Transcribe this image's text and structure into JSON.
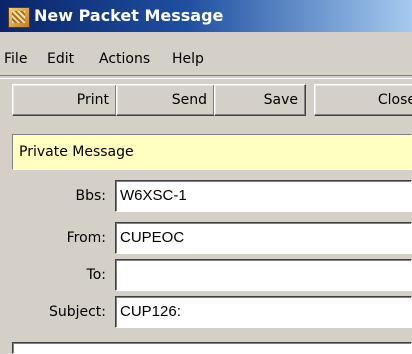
{
  "window": {
    "title": "New Packet Message",
    "icon": "packet-app-icon"
  },
  "menu": {
    "items": [
      "File",
      "Edit",
      "Actions",
      "Help"
    ]
  },
  "toolbar": {
    "buttons": [
      "Print",
      "Send",
      "Save",
      "Close"
    ]
  },
  "banner": {
    "text": "Private Message",
    "color": "#ffffc0"
  },
  "form": {
    "bbs": {
      "label": "Bbs:",
      "value": "W6XSC-1"
    },
    "from": {
      "label": "From:",
      "value": "CUPEOC"
    },
    "to": {
      "label": "To:",
      "value": ""
    },
    "subject": {
      "label": "Subject:",
      "value": "CUP126:"
    }
  },
  "body": {
    "value": ""
  }
}
